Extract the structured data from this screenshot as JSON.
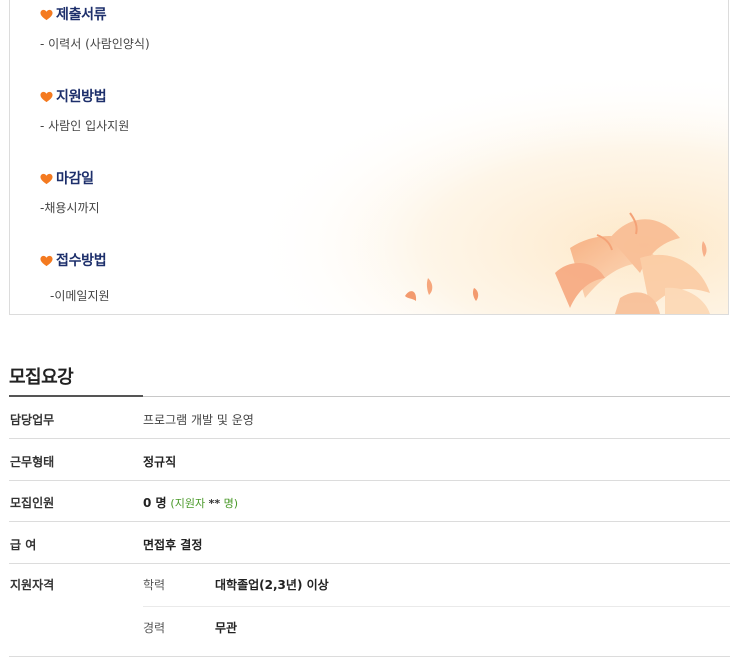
{
  "card": {
    "sections": [
      {
        "title": "제출서류",
        "text": "- 이력서 (사람인양식)"
      },
      {
        "title": "지원방법",
        "text": "- 사람인 입사지원"
      },
      {
        "title": "마감일",
        "text": "-채용시까지"
      },
      {
        "title": "접수방법",
        "text": "-이메일지원"
      }
    ],
    "icon": "heart-icon",
    "accent": "#f47a20",
    "title_color": "#1d2f6b"
  },
  "requirements": {
    "title": "모집요강",
    "rows": [
      {
        "label": "담당업무",
        "value": "프로그램 개발 및 운영"
      },
      {
        "label": "근무형태",
        "value": "정규직"
      },
      {
        "label": "모집인원",
        "value": "0 명",
        "note_prefix": "(지원자",
        "note_mask": "**",
        "note_suffix": "명)"
      },
      {
        "label": "급 여",
        "value": "면접후 결정"
      },
      {
        "label": "지원자격",
        "sub": [
          {
            "label": "학력",
            "value": "대학졸업(2,3년) 이상"
          },
          {
            "label": "경력",
            "value": "무관"
          }
        ]
      }
    ]
  }
}
